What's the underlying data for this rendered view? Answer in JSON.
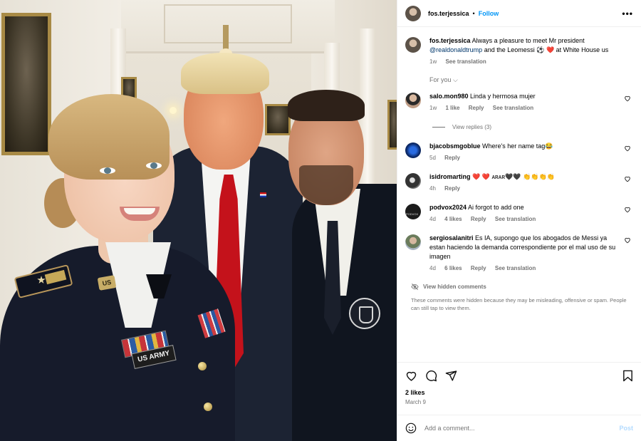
{
  "header": {
    "username": "fos.terjessica",
    "separator": "•",
    "follow_label": "Follow",
    "more_label": "•••"
  },
  "caption": {
    "username": "fos.terjessica",
    "text_before": "Always a pleasure to meet Mr president",
    "mention": "@realdonaldtrump",
    "text_after": "and the Leomessi ⚽ ❤️ at White House us",
    "time": "1w",
    "see_translation": "See translation"
  },
  "photo": {
    "nameplate_text": "US ARMY",
    "lapel_text": "US"
  },
  "for_you_label": "For you ⌵",
  "comments": [
    {
      "username": "salo.mon980",
      "text": "Linda y hermosa mujer",
      "time": "1w",
      "likes": "1 like",
      "reply": "Reply",
      "translation": "See translation",
      "view_replies": "View replies (3)"
    },
    {
      "username": "bjacobsmgoblue",
      "text": "Where's her name tag😂",
      "time": "5d",
      "likes": "",
      "reply": "Reply",
      "translation": ""
    },
    {
      "username": "isidromarting",
      "text": "❤️ ❤️ ᴀʀᴀʀ🖤🖤 👏👏👏👏",
      "time": "4h",
      "likes": "",
      "reply": "Reply",
      "translation": ""
    },
    {
      "username": "podvox2024",
      "text": "Ai forgot to add one",
      "time": "4d",
      "likes": "4 likes",
      "reply": "Reply",
      "translation": "See translation"
    },
    {
      "username": "sergiosalanitri",
      "text": "Es IA, supongo que los abogados de Messi ya estan haciendo la demanda correspondiente por el mal uso de su imagen",
      "time": "4d",
      "likes": "6 likes",
      "reply": "Reply",
      "translation": "See translation"
    }
  ],
  "hidden": {
    "link": "View hidden comments",
    "note": "These comments were hidden because they may be misleading, offensive or spam. People can still tap to view them."
  },
  "footer": {
    "likes": "2 likes",
    "date": "March 9",
    "comment_placeholder": "Add a comment...",
    "post_label": "Post"
  },
  "colors": {
    "accent": "#0095f6",
    "muted": "#737373",
    "mention": "#00376b",
    "post_disabled": "#b3dbff"
  },
  "icons": [
    "more-icon",
    "heart-icon",
    "comment-icon",
    "share-icon",
    "bookmark-icon",
    "emoji-icon",
    "eye-slash-icon"
  ]
}
